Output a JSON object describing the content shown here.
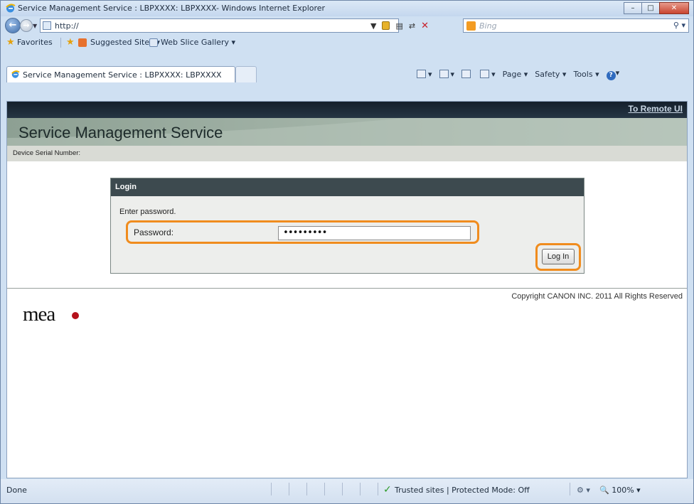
{
  "window": {
    "title": "Service Management Service : LBPXXXX: LBPXXXX- Windows Internet Explorer",
    "minimize_glyph": "–",
    "maximize_glyph": "□",
    "close_glyph": "✕"
  },
  "addressbar": {
    "url": "http://",
    "search_placeholder": "Bing"
  },
  "favorites_bar": {
    "favorites_label": "Favorites",
    "suggested_sites": "Suggested Sites ▾",
    "web_slice_gallery": "Web Slice Gallery ▾"
  },
  "tab": {
    "label": "Service Management Service : LBPXXXX: LBPXXXX"
  },
  "command_bar": {
    "page": "Page ▾",
    "safety": "Safety ▾",
    "tools": "Tools ▾",
    "help": "?"
  },
  "page": {
    "remote_ui_link": "To Remote UI",
    "title": "Service Management Service",
    "serial_label": "Device Serial Number:",
    "login": {
      "heading": "Login",
      "prompt": "Enter password.",
      "password_label": "Password:",
      "password_value": "•••••••••",
      "login_button": "Log In"
    },
    "copyright": "Copyright CANON INC. 2011 All Rights Reserved",
    "logo_text": "mea"
  },
  "statusbar": {
    "status": "Done",
    "zone": "Trusted sites | Protected Mode: Off",
    "zoom": "100%"
  },
  "colors": {
    "highlight_orange": "#f08c1e",
    "header_dark": "#14202b",
    "login_header": "#3d4a4f",
    "meap_dot": "#b5121b"
  }
}
